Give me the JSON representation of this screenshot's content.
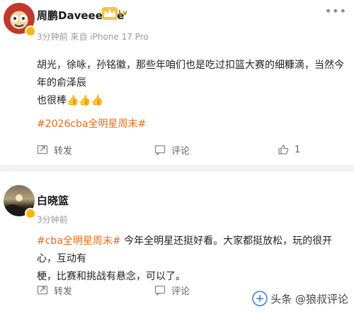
{
  "posts": [
    {
      "username": "周鹏Daveeeeee",
      "level_badge": "Lv",
      "meta": "3分钟前  来自 iPhone 17 Pro",
      "content_line1": "胡光，徐咏，孙铭徽，那些年咱们也是吃过扣篮大赛的细糠滴，当然今年的俞泽辰",
      "content_line2_text": "也很棒",
      "content_line2_emoji": "👍👍👍",
      "hashtag": "#2026cba全明星周末#",
      "repost_label": "转发",
      "comment_label": "评论",
      "like_count": "1"
    },
    {
      "username": "白晓篮",
      "meta": "3分钟前",
      "hashtag": "#cba全明星周末#",
      "content_line1_rest": " 今年全明星还挺好看。大家都挺放松，玩的很开心，互动有",
      "content_line2": "梗，比赛和挑战有悬念，可以了。",
      "repost_label": "转发",
      "comment_label": "评论"
    }
  ],
  "menu_dots": "•••",
  "watermark": "头条 @狼叔评论"
}
